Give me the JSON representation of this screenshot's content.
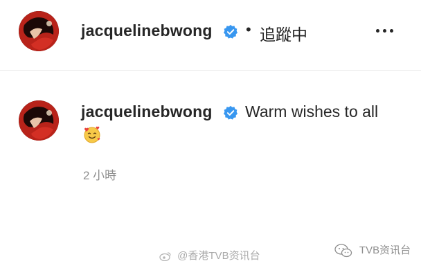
{
  "header": {
    "username": "jacquelinebwong",
    "separator": "•",
    "follow_label": "追蹤中",
    "more_icon": "more-horizontal-icon"
  },
  "comment": {
    "username": "jacquelinebwong",
    "text": "Warm wishes to all",
    "emoji": "🥰",
    "timestamp": "2 小時"
  },
  "watermarks": {
    "weibo": "@香港TVB资讯台",
    "wechat": "TVB资讯台"
  },
  "colors": {
    "verified_blue": "#3897f0",
    "text_primary": "#262626",
    "text_secondary": "#8e8e8e",
    "divider": "#ececec"
  }
}
